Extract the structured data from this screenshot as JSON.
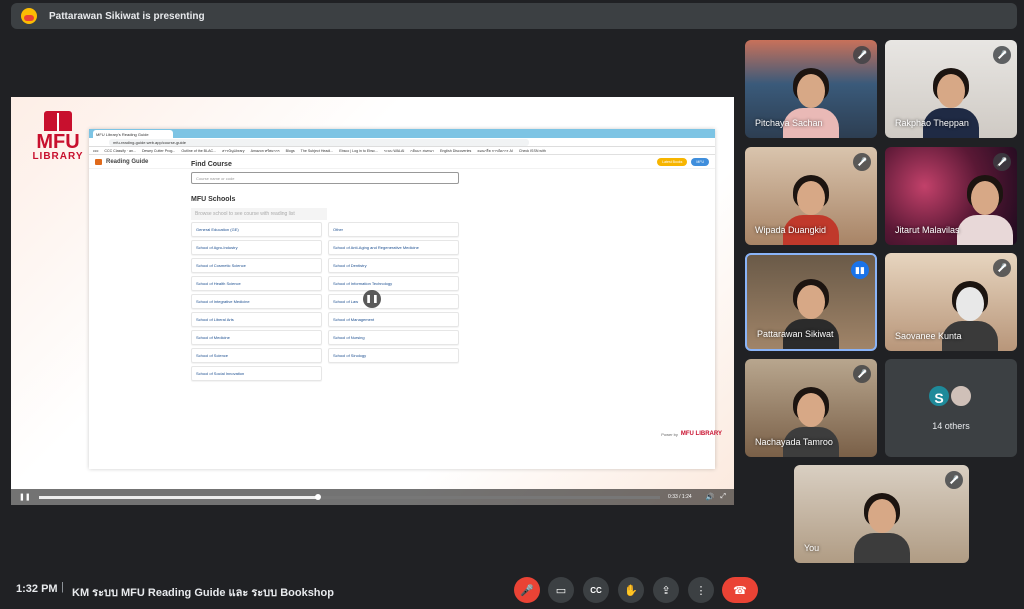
{
  "presenting_banner": "Pattarawan Sikiwat is presenting",
  "shared_screen": {
    "brand_top": "MFU",
    "brand_bottom": "LIBRARY",
    "browser_tab": "MFU Library's Reading Guide",
    "url": "mfu-reading-guide.web.app/course-guide",
    "bookmarks": [
      "ccc",
      "CCC Classify · an...",
      "Dewey Cutter Prog...",
      "Outline of the BLAC...",
      "สารบัญLibrary",
      "Amazon ทรัพยากร",
      "Blogs",
      "The Subject Headi...",
      "Ebsco | Log in to Ebsc...",
      "ระบบ WALAI",
      "กลับมา สนทนา",
      "English Discoveries",
      "คอนกรีต การจัดการ AI",
      "Check ISSN with"
    ],
    "app_title": "Reading Guide",
    "pill_yellow": "Latest Books",
    "pill_blue": "MFU",
    "find_course": "Find Course",
    "search_placeholder": "Course name or code",
    "mfu_schools": "MFU Schools",
    "browse_hint": "Browse school to see course with reading list",
    "schools": [
      "General Education (GE)",
      "Other",
      "School of Agro-Industry",
      "School of Anti-Aging and Regenerative Medicine",
      "School of Cosmetic Science",
      "School of Dentistry",
      "School of Health Science",
      "School of Information Technology",
      "School of Integrative Medicine",
      "School of Law",
      "School of Liberal Arts",
      "School of Management",
      "School of Medicine",
      "School of Nursing",
      "School of Science",
      "School of Sinology",
      "School of Social Innovation"
    ],
    "powered_by": "Power by",
    "powered_logo": "MFU LIBRARY",
    "video_time": "0:33 / 1:24",
    "video_progress": 0.45
  },
  "participants": [
    {
      "name": "Pitchaya Sachan",
      "muted": true
    },
    {
      "name": "Rakphao Theppan",
      "muted": true
    },
    {
      "name": "Wipada Duangkid",
      "muted": true
    },
    {
      "name": "Jitarut Malavilas",
      "muted": true
    },
    {
      "name": "Pattarawan Sikiwat",
      "muted": false
    },
    {
      "name": "Saovanee Kunta",
      "muted": true
    },
    {
      "name": "Nachayada Tamroo",
      "muted": true
    },
    {
      "name": "You",
      "muted": true
    }
  ],
  "others": {
    "initial": "S",
    "label": "14 others"
  },
  "footer": {
    "time": "1:32 PM",
    "separator": "|",
    "meeting": "KM ระบบ MFU Reading Guide และ ระบบ Bookshop"
  },
  "colors": {
    "end_call": "#ea4335",
    "active_speaker": "#1a73e8",
    "bg": "#202124"
  }
}
